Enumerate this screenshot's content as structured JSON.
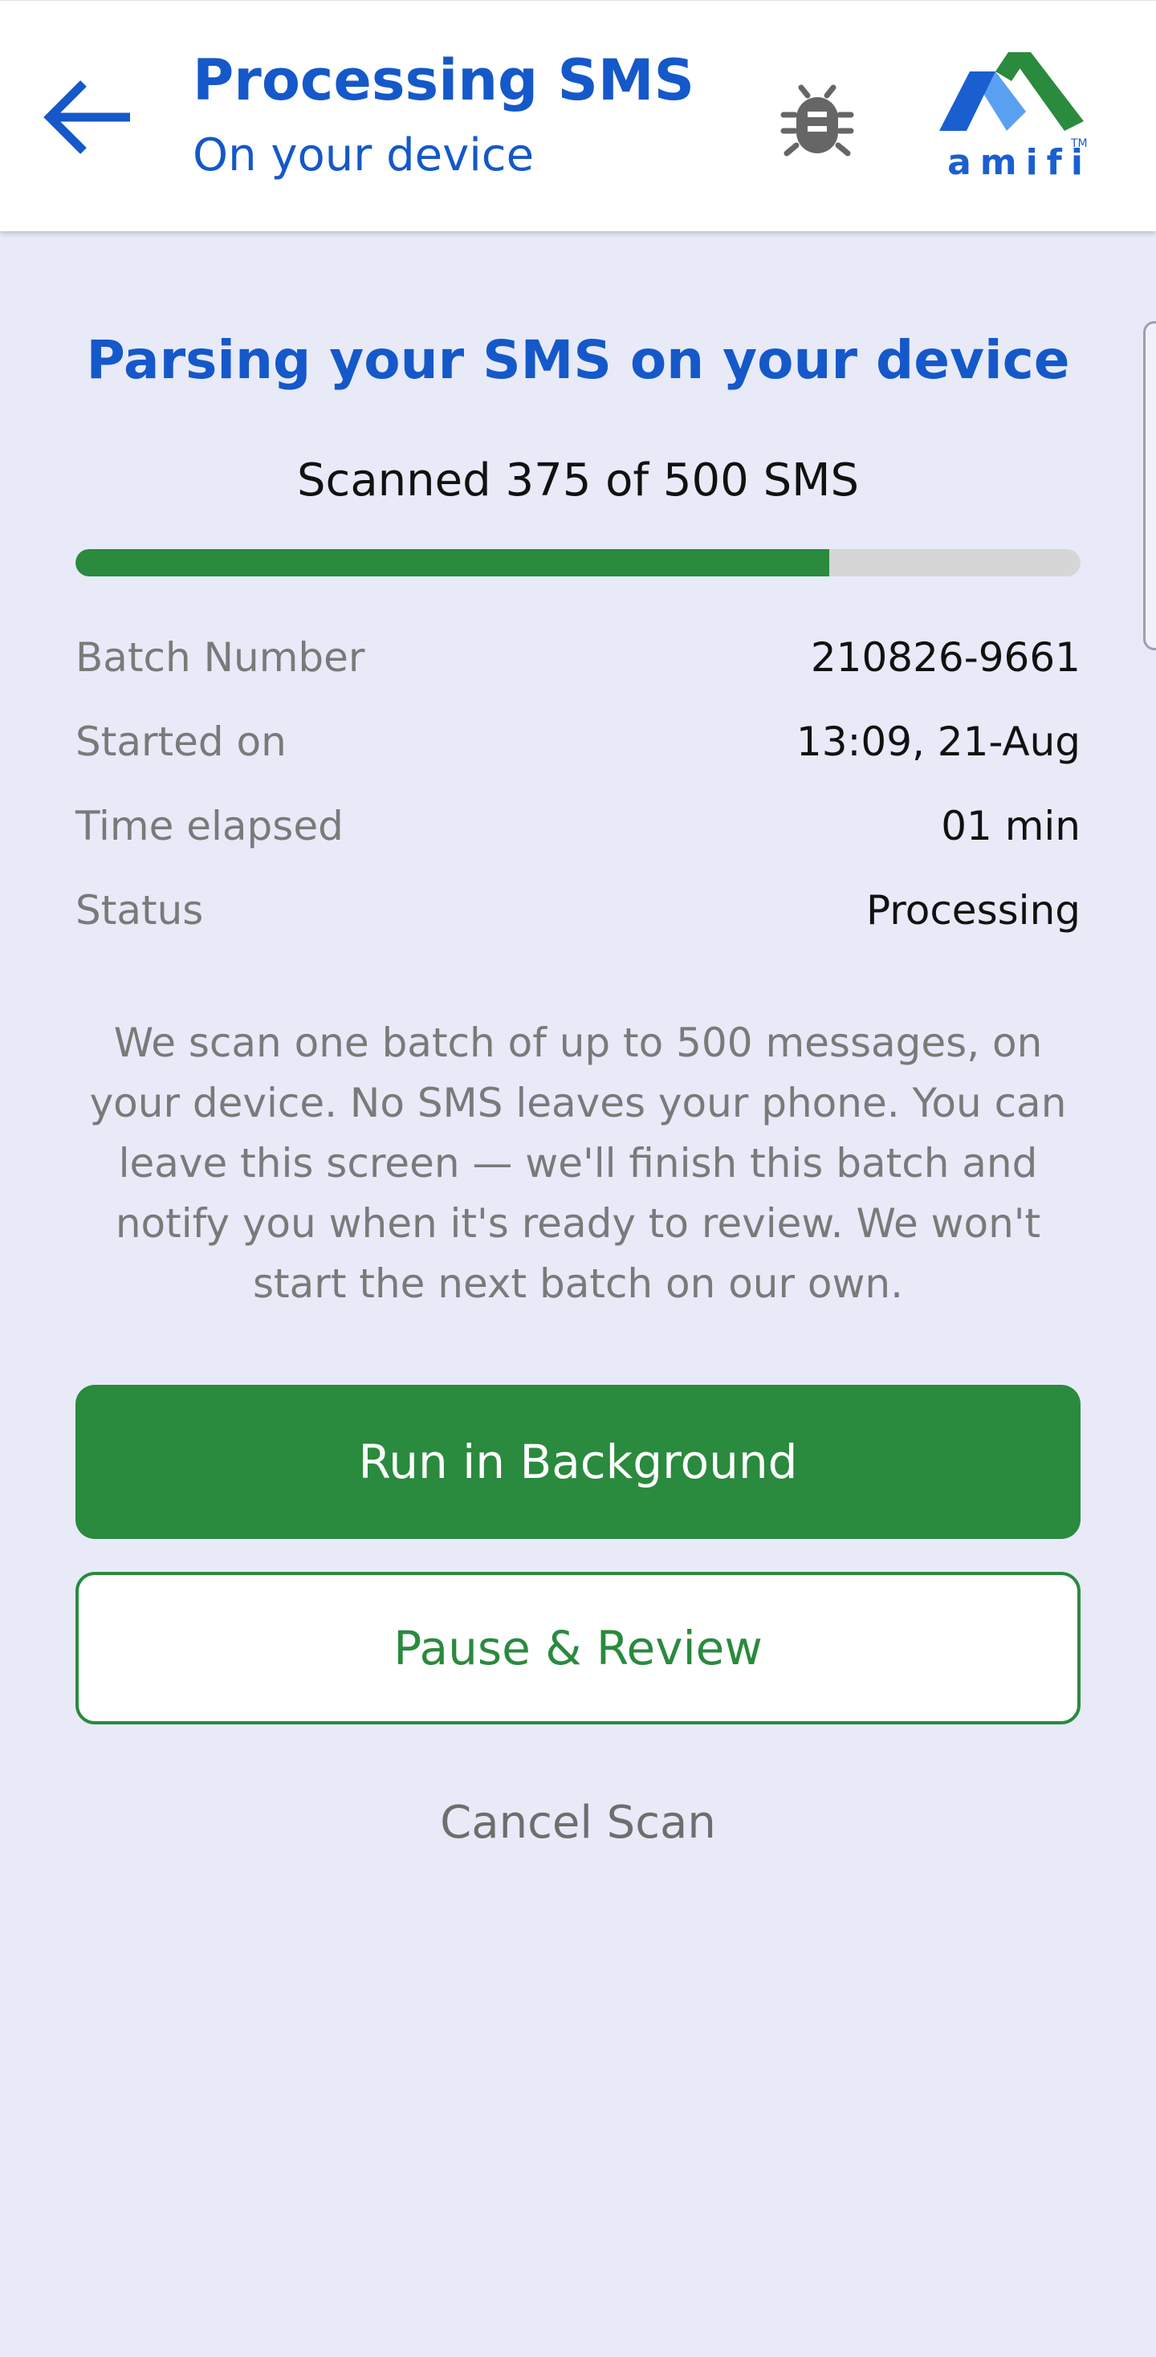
{
  "header": {
    "title": "Processing SMS",
    "subtitle": "On your device",
    "back_icon": "arrow-left-icon",
    "debug_icon": "bug-icon",
    "logo_text": "amifi",
    "logo_tm": "TM"
  },
  "colors": {
    "brand_blue": "#1558c9",
    "brand_green": "#2a8a3e",
    "background": "#e8eaf8"
  },
  "main": {
    "title": "Parsing your SMS on your device",
    "scan_status": "Scanned 375 of 500 SMS",
    "progress": {
      "scanned": 375,
      "total": 500,
      "fraction": 0.75
    },
    "details": [
      {
        "label": "Batch Number",
        "value": "210826-9661"
      },
      {
        "label": "Started on",
        "value": "13:09, 21-Aug"
      },
      {
        "label": "Time elapsed",
        "value": "01 min"
      },
      {
        "label": "Status",
        "value": "Processing"
      }
    ],
    "notice": "We scan one batch of up to 500 messages, on your device. No SMS leaves your phone. You can leave this screen — we'll finish this batch and notify you when it's ready to review. We won't start the next batch on our own."
  },
  "actions": {
    "run_background": "Run in Background",
    "pause_review": "Pause & Review",
    "cancel_scan": "Cancel Scan"
  }
}
